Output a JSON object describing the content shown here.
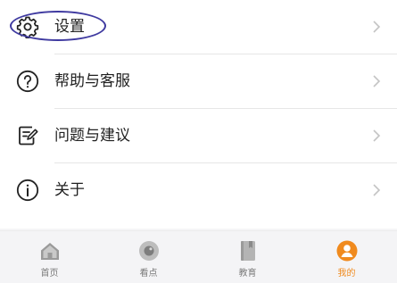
{
  "menu": {
    "items": [
      {
        "label": "设置",
        "icon": "gear-icon"
      },
      {
        "label": "帮助与客服",
        "icon": "question-circle-icon"
      },
      {
        "label": "问题与建议",
        "icon": "feedback-edit-icon"
      },
      {
        "label": "关于",
        "icon": "info-circle-icon"
      }
    ]
  },
  "tabbar": {
    "tabs": [
      {
        "label": "首页",
        "icon": "home-icon",
        "active": false
      },
      {
        "label": "看点",
        "icon": "watch-circle-icon",
        "active": false
      },
      {
        "label": "教育",
        "icon": "book-icon",
        "active": false
      },
      {
        "label": "我的",
        "icon": "person-icon",
        "active": true
      }
    ]
  },
  "colors": {
    "accent": "#f08a1e",
    "highlight": "#3f3aa0",
    "text": "#1f1f1f",
    "muted": "#7a7a7a"
  }
}
